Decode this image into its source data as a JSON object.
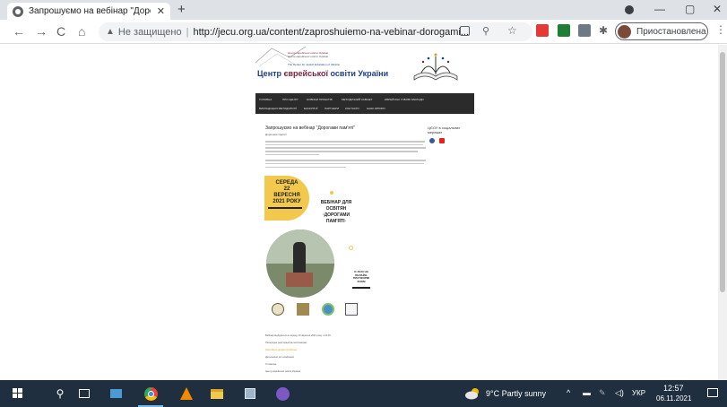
{
  "browser": {
    "tab_title": "Запрошуємо на вебінар \"Дорог",
    "tab_close": "✕",
    "new_tab": "+",
    "window": {
      "minimize": "—",
      "maximize": "▢",
      "close": "✕"
    },
    "nav": {
      "back": "←",
      "forward": "→",
      "reload": "C",
      "home": "⌂"
    },
    "address": {
      "security_label": "Не защищено",
      "separator": "|",
      "url": "http://jecu.org.ua/content/zaproshuiemo-na-vebinar-dorogami..."
    },
    "profile_label": "Приостановлена",
    "menu": "⋮"
  },
  "site": {
    "banner": {
      "line1": "Центр єврейської освіти України",
      "line2": "Центр єврейської освіти України",
      "line3": "The Center for Jewish Education of Ukraine",
      "title_part1": "Центр ",
      "title_highlight": "єврейської",
      "title_part2": " освіти ",
      "title_part3": "України"
    },
    "nav_items": [
      "ГОЛОВНА",
      "ПРО ЦЕНТР",
      "НОВИНИ ПРОЕКТІВ",
      "МЕТОДИЧНИЙ КАБІНЕТ",
      "ЄВРЕЙСЬКІ УЧБОВІ ЗАКЛАДИ",
      "ВИКЛАДАЦЬКІ МЕТОДОЛОГІЇ",
      "ЕКСКУРСІЇ",
      "ПАРТНЕРИ",
      "КОНТАКТИ",
      "НАШІ АВТОРИ"
    ],
    "article": {
      "title": "Запрошуємо на вебінар \"Дорогами пам'яті\"",
      "subtitle": "Дорогами пам'яті"
    },
    "sidebar": {
      "title": "ЦЄОУ в соціальних мережах"
    },
    "poster": {
      "date_line1": "СЕРЕДА",
      "date_line2": "22",
      "date_line3": "ВЕРЕСНЯ",
      "date_line4": "2021 РОКУ",
      "title_line1": "ВЕБІНАР ДЛЯ",
      "title_line2": "ОСВІТЯН",
      "title_line3": "·ДОРОГАМИ",
      "title_line4": "ПАМ'ЯТІ·",
      "time_line1": "О 16.00 НА",
      "time_line2": "ОНЛАЙН-",
      "time_line3": "ПЛАТФОРМІ",
      "time_line4": "ZOOM"
    },
    "bottom": {
      "line1": "Вебінар відбудеться в середу, 22 вересня 2021 року, о 16.00",
      "line2": "Попередня реєстрація за посиланням:",
      "line3": "https://docs.google.com/forms/",
      "line4": "Детальніше за телефоном",
      "line5": "З повагою,",
      "line6": "Центр єврейської освіти України"
    }
  },
  "taskbar": {
    "weather": "9°C  Partly sunny",
    "lang": "УКР",
    "time": "12:57",
    "date": "06.11.2021"
  }
}
